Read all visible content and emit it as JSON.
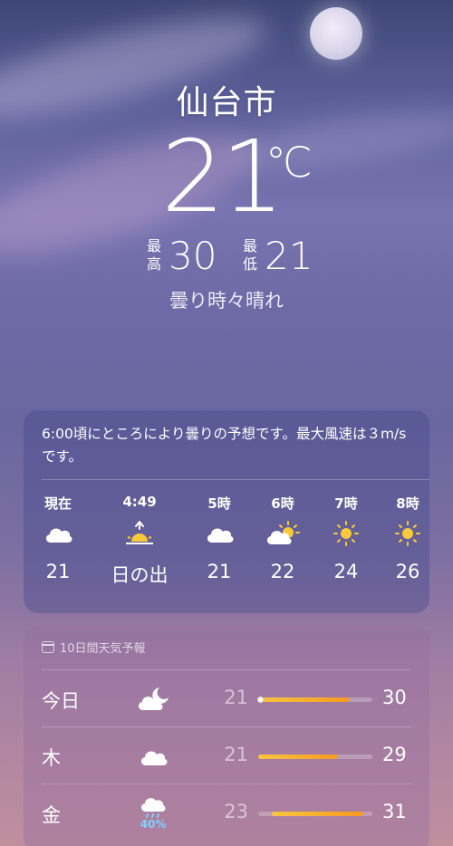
{
  "location": {
    "city": "仙台市"
  },
  "current": {
    "temperature": "21",
    "unit": "℃",
    "high_label": "最\n高",
    "high": "30",
    "low_label": "最\n低",
    "low": "21",
    "condition": "曇り時々晴れ"
  },
  "hourly": {
    "summary": "6:00頃にところにより曇りの予想です。最大風速は３m/sです。",
    "items": [
      {
        "time": "現在",
        "icon": "cloud-icon",
        "value": "21"
      },
      {
        "time": "4:49",
        "icon": "sunrise-icon",
        "value": "日の出"
      },
      {
        "time": "5時",
        "icon": "cloud-icon",
        "value": "21"
      },
      {
        "time": "6時",
        "icon": "partly-sunny-icon",
        "value": "22"
      },
      {
        "time": "7時",
        "icon": "sun-icon",
        "value": "24"
      },
      {
        "time": "8時",
        "icon": "sun-icon",
        "value": "26"
      }
    ]
  },
  "forecast": {
    "header": "10日間天気予報",
    "days": [
      {
        "day": "今日",
        "icon": "cloud-moon-icon",
        "low": "21",
        "high": "30",
        "range_start": 0.0,
        "range_end": 0.8,
        "current_marker": 0.0,
        "precip": ""
      },
      {
        "day": "木",
        "icon": "cloud-icon",
        "low": "21",
        "high": "29",
        "range_start": 0.0,
        "range_end": 0.7,
        "precip": ""
      },
      {
        "day": "金",
        "icon": "rain-cloud-icon",
        "low": "23",
        "high": "31",
        "range_start": 0.12,
        "range_end": 0.92,
        "precip": "40%"
      }
    ]
  },
  "colors": {
    "bar_start": "#f7c444",
    "bar_end": "#f59a22",
    "precip": "#7fd0ff",
    "sun": "#f8c93a"
  }
}
